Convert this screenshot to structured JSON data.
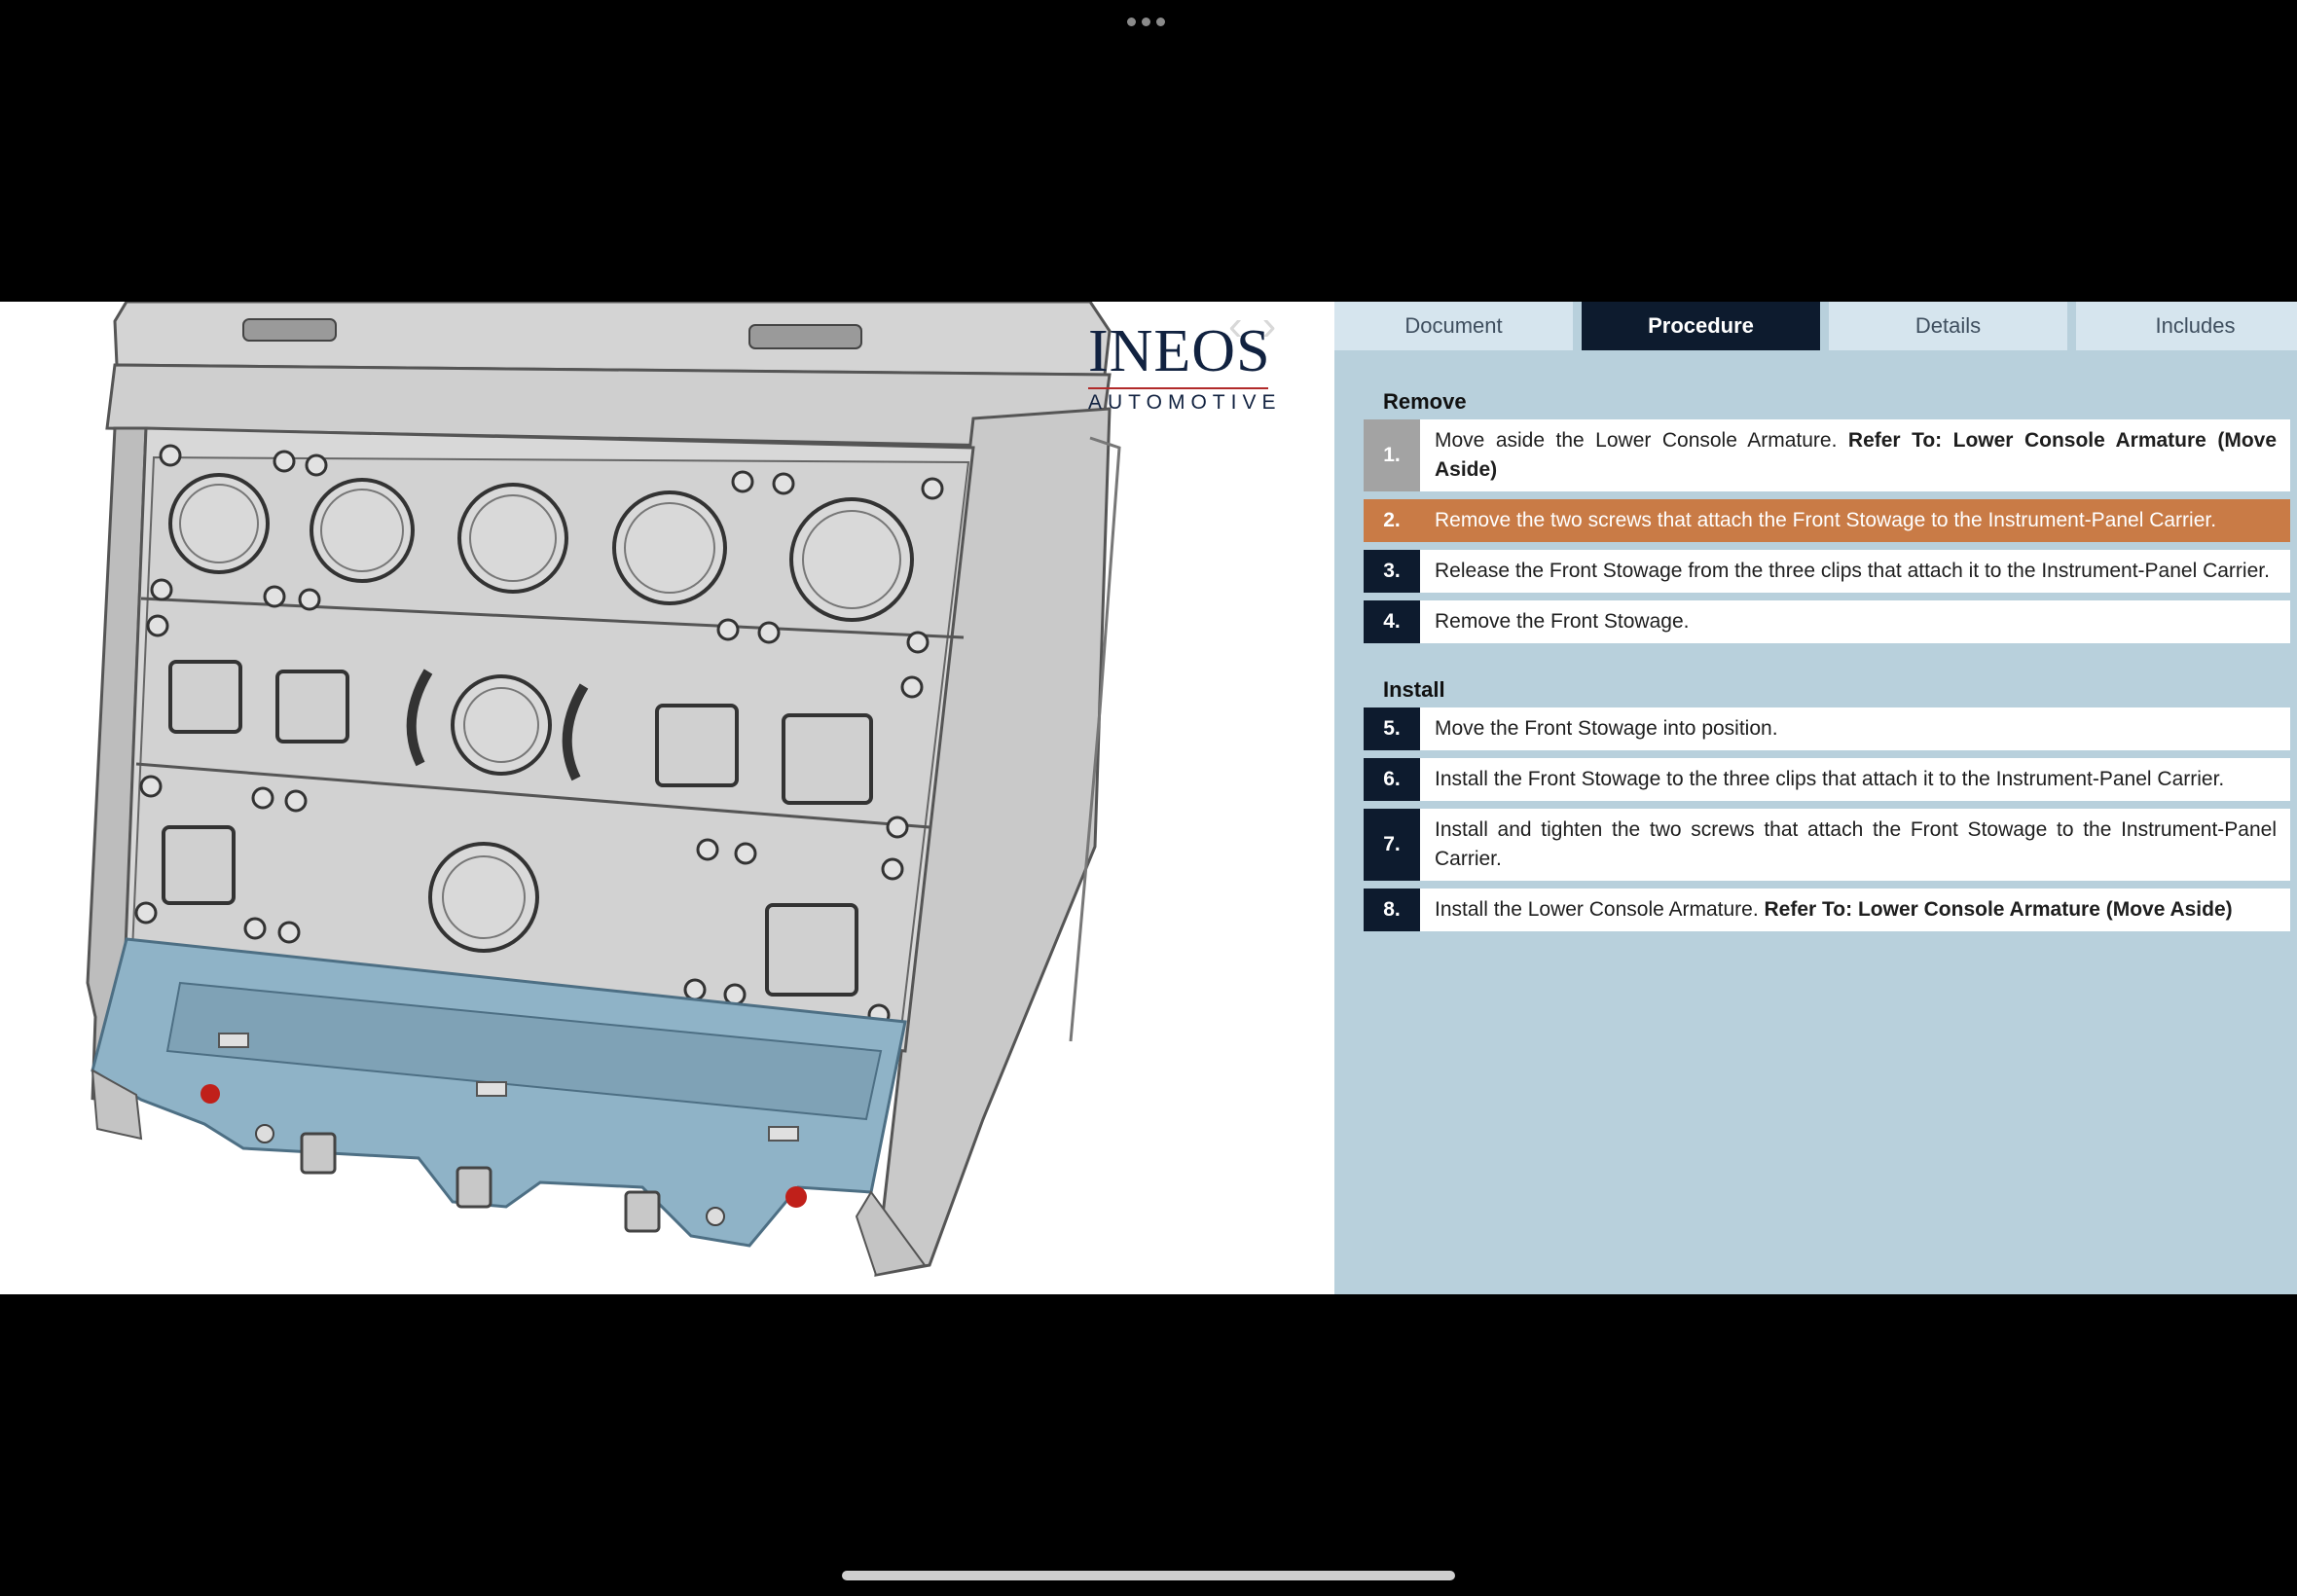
{
  "tabs": [
    {
      "label": "Document"
    },
    {
      "label": "Procedure"
    },
    {
      "label": "Details"
    },
    {
      "label": "Includes"
    }
  ],
  "active_tab": "Procedure",
  "logo": {
    "brand": "INEOS",
    "sub": "AUTOMOTIVE"
  },
  "sections": [
    {
      "title": "Remove"
    },
    {
      "title": "Install"
    }
  ],
  "steps": [
    {
      "num": "1.",
      "text": "Move aside the Lower Console Armature.",
      "ref": "Refer To: Lower Console Armature (Move Aside)"
    },
    {
      "num": "2.",
      "text": "Remove the two screws that attach the Front Stowage to the Instrument-Panel Carrier.",
      "ref": ""
    },
    {
      "num": "3.",
      "text": "Release the Front Stowage from the three clips that attach it to the Instrument-Panel Carrier.",
      "ref": ""
    },
    {
      "num": "4.",
      "text": "Remove the Front Stowage.",
      "ref": ""
    },
    {
      "num": "5.",
      "text": "Move the Front Stowage into position.",
      "ref": ""
    },
    {
      "num": "6.",
      "text": "Install the Front Stowage to the three clips that attach it to the Instrument-Panel Carrier.",
      "ref": ""
    },
    {
      "num": "7.",
      "text": "Install and tighten the two screws that attach the Front Stowage to the Instrument-Panel Carrier.",
      "ref": ""
    },
    {
      "num": "8.",
      "text": "Install the Lower Console Armature.",
      "ref": "Refer To: Lower Console Armature (Move Aside)"
    }
  ],
  "colors": {
    "panel_bg": "#b8d0dc",
    "tab_active": "#0d1b2e",
    "step_highlight": "#c97b46",
    "step_num_bg": "#0d1b2e",
    "part_highlight": "#8fb3c7"
  }
}
